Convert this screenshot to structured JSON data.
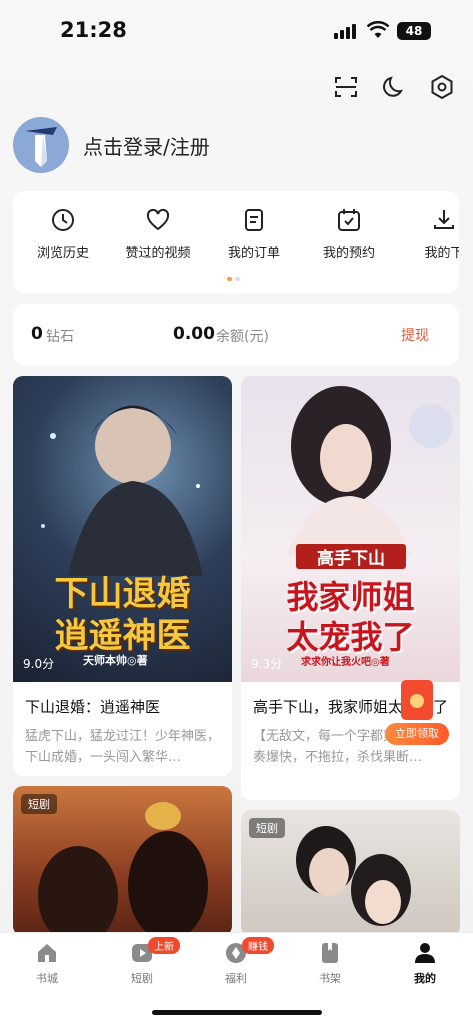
{
  "status": {
    "time": "21:28",
    "battery": "48"
  },
  "header_icons": [
    "scan-icon",
    "moon-icon",
    "settings-icon"
  ],
  "user": {
    "login_label": "点击登录/注册"
  },
  "quick_actions": [
    {
      "label": "浏览历史",
      "icon": "clock-icon"
    },
    {
      "label": "赞过的视频",
      "icon": "heart-icon"
    },
    {
      "label": "我的订单",
      "icon": "order-icon"
    },
    {
      "label": "我的预约",
      "icon": "calendar-check-icon"
    },
    {
      "label": "我的下",
      "icon": "download-icon"
    }
  ],
  "wallet": {
    "diamonds_value": "0",
    "diamonds_unit": "钻石",
    "balance_value": "0.00",
    "balance_unit": "余额(元)",
    "withdraw_label": "提现"
  },
  "books": [
    {
      "title": "下山退婚：逍遥神医",
      "desc": "猛虎下山，猛龙过江！少年神医，下山成婚，一头闯入繁华…",
      "score": "9.0分",
      "cover_line1": "下山退婚",
      "cover_line2": "逍遥神医",
      "cover_author": "天师本帅◎著"
    },
    {
      "title": "高手下山，我家师姐太宠我了",
      "desc": "【无敌文，每一个字都爽，剧情节奏爆快，不拖拉，杀伐果断…",
      "score": "9.3分",
      "cover_top": "高手下山",
      "cover_line1": "我家师姐",
      "cover_line2": "太宠我了",
      "cover_author": "求求你让我火吧◎著"
    },
    {
      "tag": "短剧"
    },
    {
      "tag": "短剧"
    }
  ],
  "redpack": {
    "label": "立即领取"
  },
  "tabs": [
    {
      "label": "书城",
      "icon": "home-icon"
    },
    {
      "label": "短剧",
      "icon": "play-icon",
      "badge": "上新"
    },
    {
      "label": "福利",
      "icon": "gift-icon",
      "badge": "赚钱"
    },
    {
      "label": "书架",
      "icon": "bookmark-icon"
    },
    {
      "label": "我的",
      "icon": "person-icon"
    }
  ],
  "colors": {
    "accent": "#e35a3a",
    "dot_active": "#f1a534",
    "badge": "#f04a2e"
  }
}
